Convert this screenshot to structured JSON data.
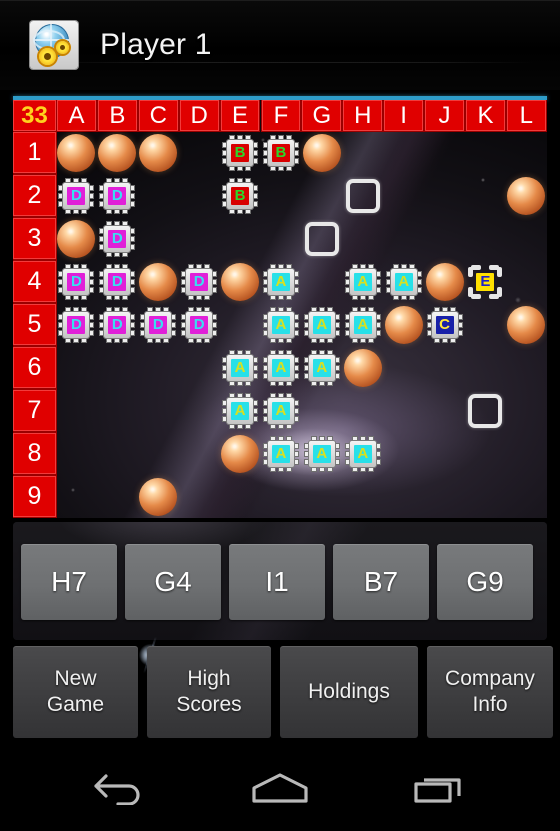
{
  "titlebar": {
    "app_icon": "globe-gear-icon",
    "title": "Player 1"
  },
  "board": {
    "corner_label": "33",
    "columns": [
      "A",
      "B",
      "C",
      "D",
      "E",
      "F",
      "G",
      "H",
      "I",
      "J",
      "K",
      "L"
    ],
    "rows": [
      "1",
      "2",
      "3",
      "4",
      "5",
      "6",
      "7",
      "8",
      "9"
    ],
    "colors": {
      "header_red": "#e00000",
      "corner_text": "#ffd21e",
      "accent_blue": "#2e9cc9"
    },
    "tile_styles": {
      "A": {
        "label": "A",
        "bg": "#28e0e8",
        "fg": "#d8e020",
        "name": "hotel-a"
      },
      "B": {
        "label": "B",
        "bg": "#d80000",
        "fg": "#2ad82a",
        "name": "hotel-b"
      },
      "C": {
        "label": "C",
        "bg": "#1820a8",
        "fg": "#ffe83a",
        "name": "hotel-c"
      },
      "D": {
        "label": "D",
        "bg": "#e020d8",
        "fg": "#38e0f0",
        "name": "hotel-d"
      },
      "E": {
        "label": "E",
        "bg": "#ffe000",
        "fg": "#2020c8",
        "name": "hotel-e"
      }
    },
    "cells": [
      {
        "col": "A",
        "row": "1",
        "kind": "sphere"
      },
      {
        "col": "B",
        "row": "1",
        "kind": "sphere"
      },
      {
        "col": "C",
        "row": "1",
        "kind": "sphere"
      },
      {
        "col": "E",
        "row": "1",
        "kind": "chip",
        "tile": "B"
      },
      {
        "col": "F",
        "row": "1",
        "kind": "chip",
        "tile": "B"
      },
      {
        "col": "G",
        "row": "1",
        "kind": "sphere"
      },
      {
        "col": "A",
        "row": "2",
        "kind": "chip",
        "tile": "D"
      },
      {
        "col": "B",
        "row": "2",
        "kind": "chip",
        "tile": "D"
      },
      {
        "col": "E",
        "row": "2",
        "kind": "chip",
        "tile": "B"
      },
      {
        "col": "H",
        "row": "2",
        "kind": "outline"
      },
      {
        "col": "L",
        "row": "2",
        "kind": "sphere"
      },
      {
        "col": "A",
        "row": "3",
        "kind": "sphere"
      },
      {
        "col": "B",
        "row": "3",
        "kind": "chip",
        "tile": "D"
      },
      {
        "col": "G",
        "row": "3",
        "kind": "outline"
      },
      {
        "col": "A",
        "row": "4",
        "kind": "chip",
        "tile": "D"
      },
      {
        "col": "B",
        "row": "4",
        "kind": "chip",
        "tile": "D"
      },
      {
        "col": "C",
        "row": "4",
        "kind": "sphere"
      },
      {
        "col": "D",
        "row": "4",
        "kind": "chip",
        "tile": "D"
      },
      {
        "col": "E",
        "row": "4",
        "kind": "sphere"
      },
      {
        "col": "F",
        "row": "4",
        "kind": "chip",
        "tile": "A"
      },
      {
        "col": "H",
        "row": "4",
        "kind": "chip",
        "tile": "A"
      },
      {
        "col": "I",
        "row": "4",
        "kind": "chip",
        "tile": "A"
      },
      {
        "col": "J",
        "row": "4",
        "kind": "sphere"
      },
      {
        "col": "K",
        "row": "4",
        "kind": "chip",
        "tile": "E",
        "frame": "bracket"
      },
      {
        "col": "A",
        "row": "5",
        "kind": "chip",
        "tile": "D"
      },
      {
        "col": "B",
        "row": "5",
        "kind": "chip",
        "tile": "D"
      },
      {
        "col": "C",
        "row": "5",
        "kind": "chip",
        "tile": "D"
      },
      {
        "col": "D",
        "row": "5",
        "kind": "chip",
        "tile": "D"
      },
      {
        "col": "F",
        "row": "5",
        "kind": "chip",
        "tile": "A"
      },
      {
        "col": "G",
        "row": "5",
        "kind": "chip",
        "tile": "A"
      },
      {
        "col": "H",
        "row": "5",
        "kind": "chip",
        "tile": "A"
      },
      {
        "col": "I",
        "row": "5",
        "kind": "sphere"
      },
      {
        "col": "J",
        "row": "5",
        "kind": "chip",
        "tile": "C"
      },
      {
        "col": "L",
        "row": "5",
        "kind": "sphere"
      },
      {
        "col": "E",
        "row": "6",
        "kind": "chip",
        "tile": "A"
      },
      {
        "col": "F",
        "row": "6",
        "kind": "chip",
        "tile": "A"
      },
      {
        "col": "G",
        "row": "6",
        "kind": "chip",
        "tile": "A"
      },
      {
        "col": "H",
        "row": "6",
        "kind": "sphere"
      },
      {
        "col": "E",
        "row": "7",
        "kind": "chip",
        "tile": "A"
      },
      {
        "col": "F",
        "row": "7",
        "kind": "chip",
        "tile": "A"
      },
      {
        "col": "K",
        "row": "7",
        "kind": "outline"
      },
      {
        "col": "E",
        "row": "8",
        "kind": "sphere"
      },
      {
        "col": "F",
        "row": "8",
        "kind": "chip",
        "tile": "A"
      },
      {
        "col": "G",
        "row": "8",
        "kind": "chip",
        "tile": "A"
      },
      {
        "col": "H",
        "row": "8",
        "kind": "chip",
        "tile": "A"
      },
      {
        "col": "C",
        "row": "9",
        "kind": "sphere"
      }
    ]
  },
  "rack": {
    "tiles": [
      "H7",
      "G4",
      "I1",
      "B7",
      "G9"
    ]
  },
  "actions": [
    {
      "label": "New\nGame",
      "name": "new-game-button"
    },
    {
      "label": "High\nScores",
      "name": "high-scores-button"
    },
    {
      "label": "Holdings",
      "name": "holdings-button"
    },
    {
      "label": "Company\nInfo",
      "name": "company-info-button"
    }
  ],
  "navbar": {
    "back": "back-icon",
    "home": "home-icon",
    "recents": "recents-icon"
  }
}
